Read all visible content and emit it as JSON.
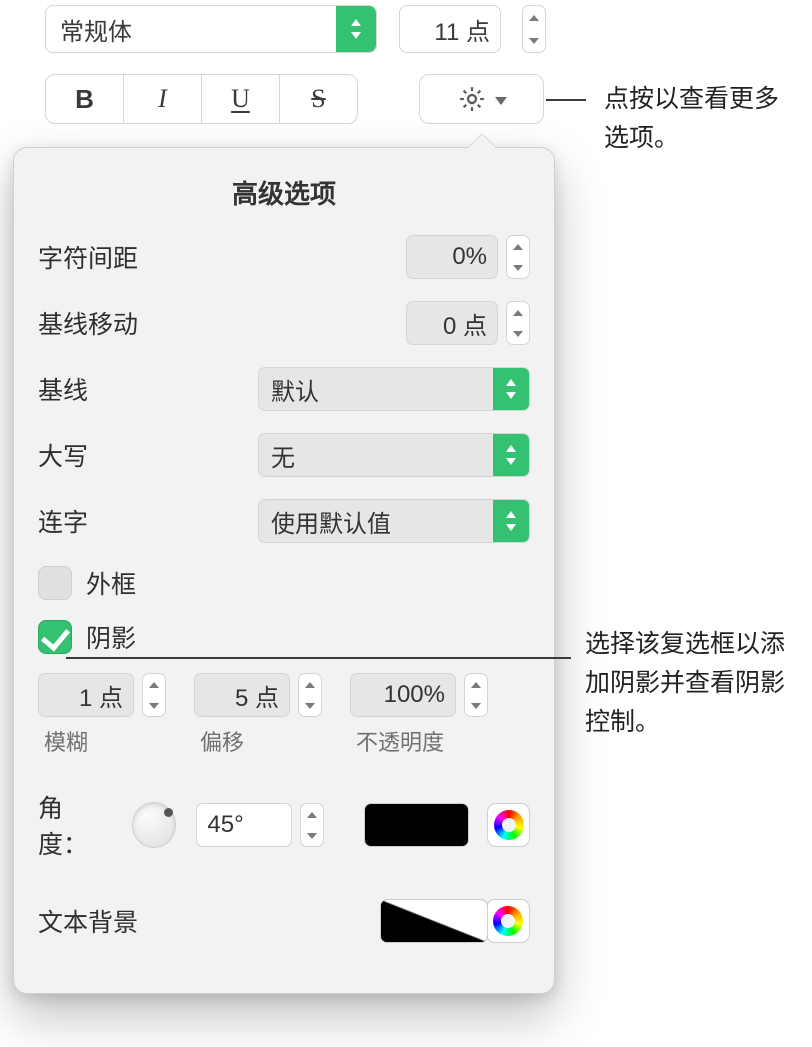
{
  "font": {
    "style": "常规体",
    "size": "11 点"
  },
  "gear_callout": "点按以查看更多选项。",
  "shadow_callout": "选择该复选框以添加阴影并查看阴影控制。",
  "popover": {
    "title": "高级选项",
    "char_spacing": {
      "label": "字符间距",
      "value": "0%"
    },
    "baseline_shift": {
      "label": "基线移动",
      "value": "0 点"
    },
    "baseline": {
      "label": "基线",
      "value": "默认"
    },
    "capitalization": {
      "label": "大写",
      "value": "无"
    },
    "ligatures": {
      "label": "连字",
      "value": "使用默认值"
    },
    "outline": {
      "label": "外框",
      "checked": false
    },
    "shadow": {
      "label": "阴影",
      "checked": true,
      "blur": {
        "value": "1 点",
        "label": "模糊"
      },
      "offset": {
        "value": "5 点",
        "label": "偏移"
      },
      "opacity": {
        "value": "100%",
        "label": "不透明度"
      },
      "angle": {
        "label": "角度：",
        "value": "45°"
      }
    },
    "text_bg": {
      "label": "文本背景"
    }
  },
  "style_buttons": {
    "bold": "B",
    "italic": "I",
    "underline": "U",
    "strike": "S"
  }
}
